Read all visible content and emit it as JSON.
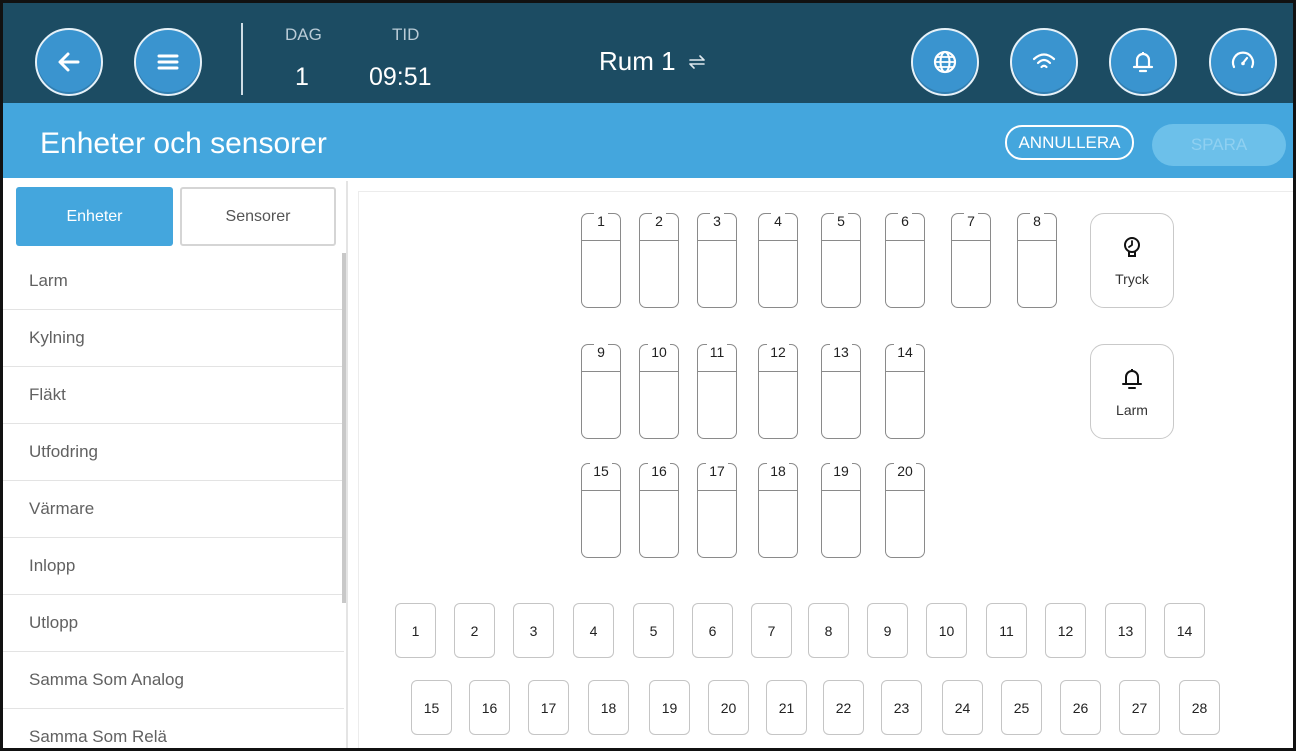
{
  "header": {
    "day_label": "DAG",
    "day_value": "1",
    "time_label": "TID",
    "time_value": "09:51",
    "room": "Rum 1"
  },
  "title_bar": {
    "title": "Enheter och sensorer",
    "cancel_label": "ANNULLERA",
    "save_label": "SPARA"
  },
  "tabs": {
    "devices": "Enheter",
    "sensors": "Sensorer"
  },
  "sidebar": {
    "items": [
      "Larm",
      "Kylning",
      "Fläkt",
      "Utfodring",
      "Värmare",
      "Inlopp",
      "Utlopp",
      "Samma Som Analog",
      "Samma Som Relä"
    ]
  },
  "relays": [
    "1",
    "2",
    "3",
    "4",
    "5",
    "6",
    "7",
    "8",
    "9",
    "10",
    "11",
    "12",
    "13",
    "14",
    "15",
    "16",
    "17",
    "18",
    "19",
    "20"
  ],
  "special": {
    "pressure_label": "Tryck",
    "alarm_label": "Larm"
  },
  "digital_inputs": [
    "1",
    "2",
    "3",
    "4",
    "5",
    "6",
    "7",
    "8",
    "9",
    "10",
    "11",
    "12",
    "13",
    "14",
    "15",
    "16",
    "17",
    "18",
    "19",
    "20",
    "21",
    "22",
    "23",
    "24",
    "25",
    "26",
    "27",
    "28"
  ],
  "colors": {
    "header_bg": "#1c4c63",
    "accent": "#44a6dd",
    "button_fill": "#3a94cf"
  },
  "icons": {
    "back": "arrow-left-icon",
    "menu": "hamburger-icon",
    "globe": "globe-icon",
    "wifi": "wifi-icon",
    "bell": "bell-icon",
    "gauge": "gauge-icon",
    "swap": "swap-arrows-icon",
    "pressure": "pressure-sensor-icon",
    "alarm": "bell-icon"
  }
}
